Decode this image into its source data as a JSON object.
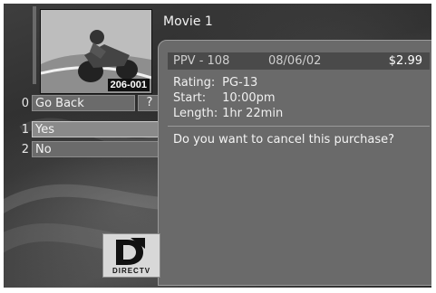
{
  "movie": {
    "title": "Movie 1",
    "thumbnail_code": "206-001"
  },
  "menu": {
    "go_back": {
      "number": "0",
      "label": "Go Back"
    },
    "help_label": "?",
    "yes": {
      "number": "1",
      "label": "Yes"
    },
    "no": {
      "number": "2",
      "label": "No"
    }
  },
  "purchase": {
    "channel": "PPV - 108",
    "date": "08/06/02",
    "price": "$2.99",
    "rating_label": "Rating:",
    "rating": "PG-13",
    "start_label": "Start:",
    "start": "10:00pm",
    "length_label": "Length:",
    "length": "1hr 22min",
    "question": "Do you want to cancel this purchase?"
  },
  "logo": {
    "text": "DIRECTV"
  }
}
